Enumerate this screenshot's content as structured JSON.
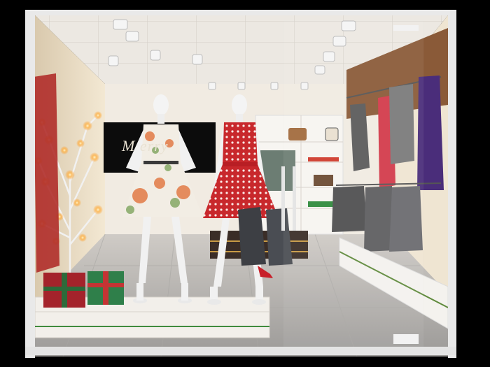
{
  "scene": {
    "description_free": true,
    "store_sign": {
      "text": "M        erry"
    },
    "colors": {
      "wall": "#efe3cc",
      "ceiling": "#ece8e2",
      "floor": "#b9b7b5",
      "dress_red": "#c8282c",
      "dress_floral_base": "#f2ede4",
      "sign_bg": "#0c0c0c",
      "frame": "#e9e9e9"
    }
  }
}
